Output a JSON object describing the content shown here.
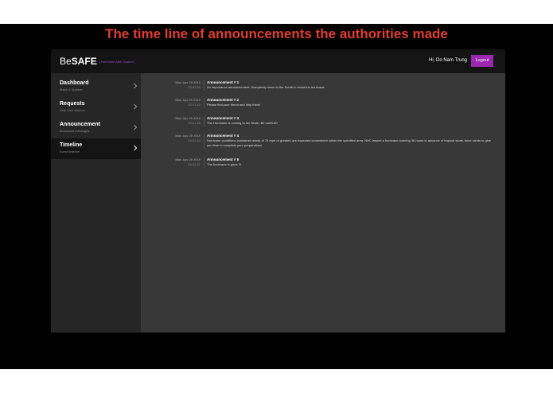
{
  "headline": "The time line of announcements the authorities made",
  "header": {
    "brand_light": "Be",
    "brand_bold": "SAFE",
    "brand_tag": "[ Hurricane Alert System ]",
    "greeting": "Hi, Do Nam Trung",
    "logout_label": "Logout"
  },
  "sidebar": {
    "items": [
      {
        "title": "Dashboard",
        "subtitle": "Maps & Number"
      },
      {
        "title": "Requests",
        "subtitle": "Help from citizens"
      },
      {
        "title": "Announcement",
        "subtitle": "Broadcast messages"
      },
      {
        "title": "Timeline",
        "subtitle": "Event timeline"
      }
    ],
    "active": "Timeline"
  },
  "timeline": [
    {
      "date": "Mon Apr 29 2019",
      "time": "20:01:30",
      "title": "Announcement # 1",
      "body": "An importance announcement: Everybody move to the South to avoid the hurricane."
    },
    {
      "date": "Mon Apr 29 2019",
      "time": "20:01:42",
      "title": "Announcement # 2",
      "body": "Please find your friend and help them!"
    },
    {
      "date": "Mon Apr 29 2019",
      "time": "20:01:55",
      "title": "Announcement # 3",
      "body": "The Hurricane is coming to the North, Be carefull!!"
    },
    {
      "date": "Mon Apr 29 2019",
      "time": "20:02:43",
      "title": "Announcement # 4",
      "body": "Hurricane conditions (sustained winds of 74 mph or greater) are expected somewhere within the specified area. NHC issues a hurricane warning 36 hours in advance of tropical storm-force winds to give you time to complete your preparations."
    },
    {
      "date": "Mon Apr 29 2019",
      "time": "20:02:57",
      "title": "Announcement # 5",
      "body": "The hurricane is gone !!!"
    }
  ],
  "colors": {
    "headline": "#e23d2e",
    "accent": "#9c27b0",
    "topbar": "#141414",
    "sidebar": "#262626",
    "content": "#383838"
  }
}
